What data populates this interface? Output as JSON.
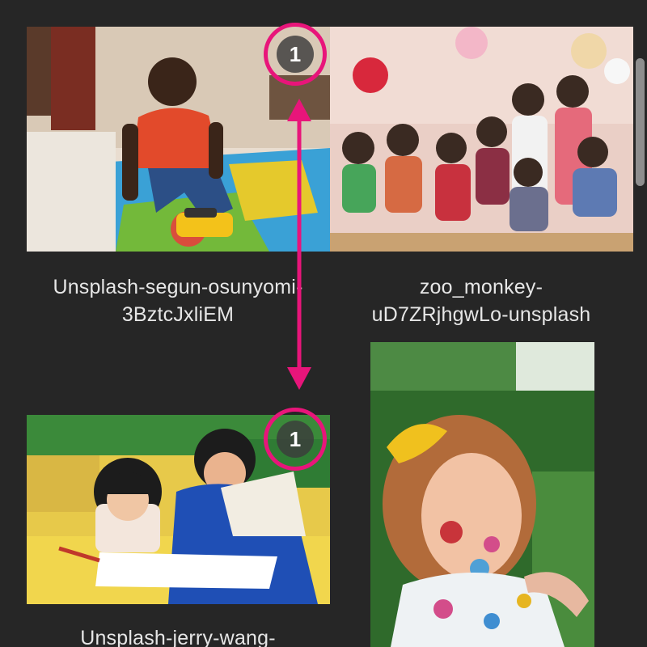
{
  "gallery": {
    "items": [
      {
        "caption": "Unsplash-segun-osunyomi-\n3BztcJxliEM",
        "badge": "1"
      },
      {
        "caption": "zoo_monkey-\nuD7ZRjhgwLo-unsplash"
      },
      {
        "caption": "Unsplash-jerry-wang-",
        "badge": "1"
      },
      {
        "caption": ""
      }
    ]
  },
  "annotation": {
    "color": "#e8157a"
  }
}
